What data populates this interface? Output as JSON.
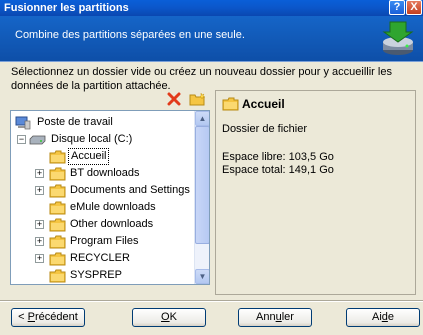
{
  "window": {
    "title": "Fusionner les partitions",
    "help_glyph": "?",
    "close_glyph": "X"
  },
  "header": {
    "text": "Combine des partitions séparées en une seule."
  },
  "instruction": "Sélectionnez un dossier vide ou créez un nouveau dossier pour y accueillir les données de la partition attachée.",
  "tree": {
    "root": "Poste de travail",
    "drive": "Disque local (C:)",
    "items": [
      {
        "label": "Accueil",
        "expander": false,
        "selected": true
      },
      {
        "label": "BT downloads",
        "expander": true
      },
      {
        "label": "Documents and Settings",
        "expander": true
      },
      {
        "label": "eMule downloads",
        "expander": false
      },
      {
        "label": "Other downloads",
        "expander": true
      },
      {
        "label": "Program Files",
        "expander": true
      },
      {
        "label": "RECYCLER",
        "expander": true
      },
      {
        "label": "SYSPREP",
        "expander": false
      }
    ]
  },
  "info": {
    "title": "Accueil",
    "type": "Dossier de fichier",
    "free": "Espace libre: 103,5 Go",
    "total": "Espace total: 149,1 Go"
  },
  "buttons": {
    "prev_prefix": "< ",
    "prev_mnemonic": "P",
    "prev_rest": "récédent",
    "ok_mnemonic": "O",
    "ok_rest": "K",
    "cancel_prefix": "Ann",
    "cancel_mnemonic": "u",
    "cancel_rest": "ler",
    "help_prefix": "Ai",
    "help_mnemonic": "d",
    "help_rest": "e"
  },
  "colors": {
    "titlebar": "#0a5fd8",
    "header": "#1565c8",
    "folder": "#f5c542",
    "delete_icon": "#e23a1a"
  }
}
